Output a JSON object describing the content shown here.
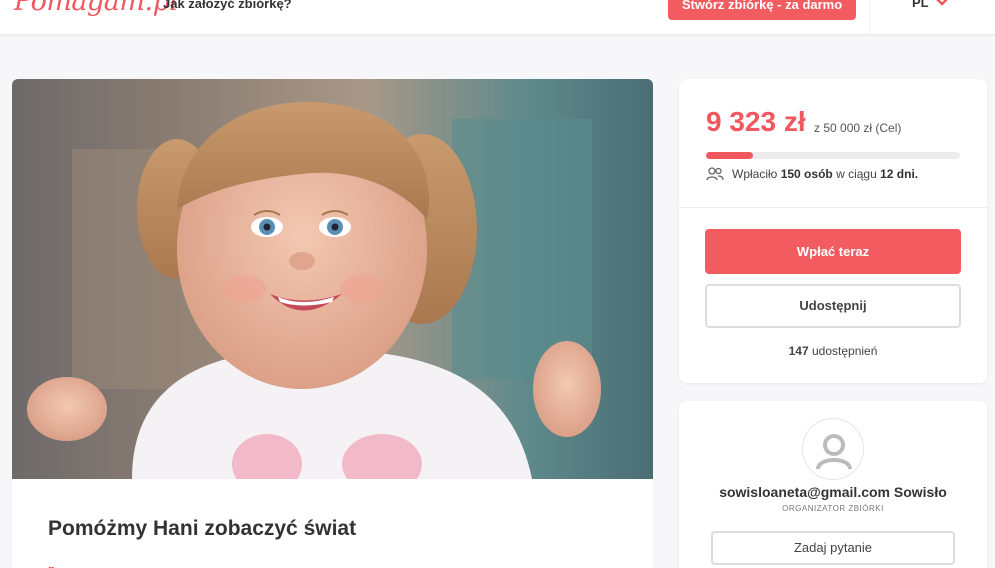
{
  "header": {
    "logo": "Pomagam.pl",
    "howto_link": "Jak założyć zbiórkę?",
    "create_button": "Stwórz zbiórkę - za darmo",
    "language": "PL"
  },
  "campaign": {
    "title": "Pomóżmy Hani zobaczyć świat"
  },
  "donation": {
    "raised": "9 323 zł",
    "goal_text": "z 50 000 zł (Cel)",
    "progress_fraction": 0.186,
    "stats_prefix": "Wpłaciło",
    "stats_people": "150 osób",
    "stats_mid": "w ciągu",
    "stats_days": "12 dni.",
    "pay_button": "Wpłać teraz",
    "share_button": "Udostępnij",
    "shares_count": "147",
    "shares_label": "udostępnień"
  },
  "organizer": {
    "name": "sowisloaneta@gmail.com Sowisło",
    "role": "ORGANIZATOR ZBIÓRKI",
    "ask_button": "Zadaj pytanie"
  },
  "colors": {
    "accent": "#f0575f",
    "progress_track": "#ececef"
  }
}
